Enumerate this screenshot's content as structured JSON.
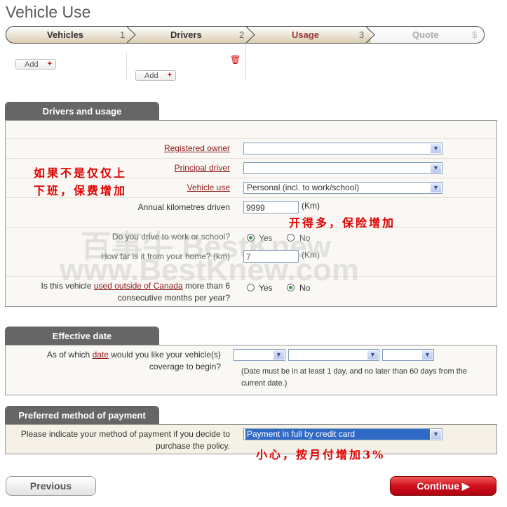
{
  "title": "Vehicle Use",
  "steps": [
    {
      "label": "Vehicles",
      "num": "1"
    },
    {
      "label": "Drivers",
      "num": "2"
    },
    {
      "label": "Usage",
      "num": "3"
    },
    {
      "label": "Quote",
      "num": "$"
    }
  ],
  "add_label": "Add",
  "sections": {
    "drivers": {
      "title": "Drivers and usage",
      "registered_owner": "Registered owner",
      "principal_driver": "Principal driver",
      "vehicle_use": "Vehicle use",
      "vehicle_use_value": "Personal (incl. to work/school)",
      "annual_km": "Annual kilometres driven",
      "annual_km_value": "9999",
      "km_unit": "(Km)",
      "drive_work": "Do you drive to work or school?",
      "yes": "Yes",
      "no": "No",
      "drive_work_value": "Yes",
      "how_far": "How far is it from your home? (km)",
      "how_far_value": "7",
      "outside_pre": "Is this vehicle ",
      "outside_link": "used outside of Canada",
      "outside_post": " more than 6 consecutive months per year?",
      "outside_value": "No"
    },
    "effective": {
      "title": "Effective date",
      "q_pre": "As of which ",
      "q_link": "date",
      "q_post": " would you like your vehicle(s) coverage to begin?",
      "note": "(Date must be in at least 1 day, and no later than 60 days from the current date.)"
    },
    "payment": {
      "title": "Preferred method of payment",
      "question": "Please indicate your method of payment if you decide to purchase the policy.",
      "value": "Payment in full by credit card"
    }
  },
  "annotations": {
    "usage": [
      "如果不是仅仅上",
      "下班，保费增加"
    ],
    "km": "开得多，保险增加",
    "payment": "小心，按月付增加3%"
  },
  "watermark": {
    "line1": "百事牛 BestKnew",
    "line2": "www.BestKnew.com"
  },
  "buttons": {
    "previous": "Previous",
    "continue": "Continue"
  },
  "colors": {
    "accent": "#8b1a1a",
    "continue": "#d0101c",
    "tab": "#666666"
  }
}
